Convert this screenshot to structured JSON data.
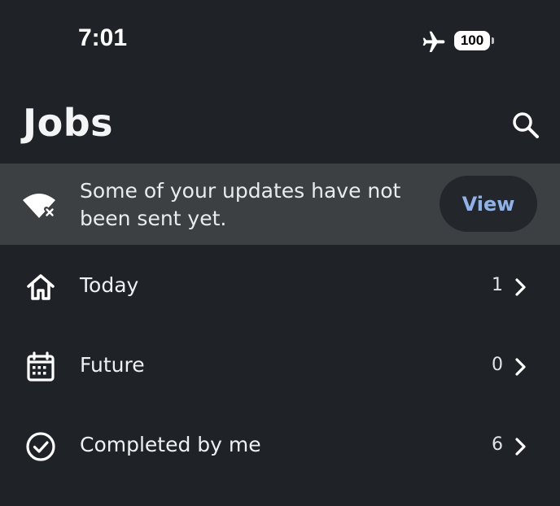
{
  "status_bar": {
    "time": "7:01",
    "battery": "100"
  },
  "header": {
    "title": "Jobs",
    "search_icon": "search-icon"
  },
  "banner": {
    "icon": "wifi-off-icon",
    "message": "Some of your updates have not been sent yet.",
    "action_label": "View",
    "background": "#3d4043",
    "action_color": "#8fb3e8"
  },
  "list": [
    {
      "icon": "home-icon",
      "label": "Today",
      "count": "1"
    },
    {
      "icon": "calendar-icon",
      "label": "Future",
      "count": "0"
    },
    {
      "icon": "check-circle-icon",
      "label": "Completed by me",
      "count": "6"
    }
  ],
  "colors": {
    "background": "#1f2328",
    "text": "#eef0f2"
  }
}
